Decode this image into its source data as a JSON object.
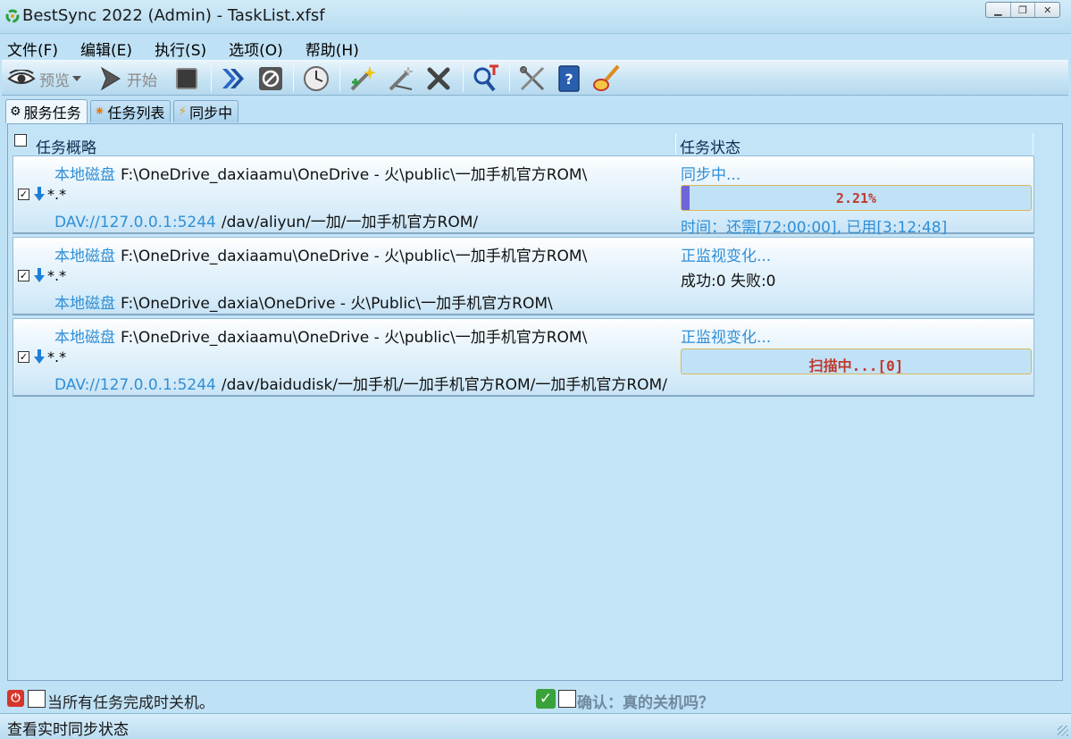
{
  "window": {
    "title": "BestSync 2022 (Admin) - TaskList.xfsf",
    "controls": [
      "minimize",
      "restore",
      "close"
    ]
  },
  "menu": [
    "文件(F)",
    "编辑(E)",
    "执行(S)",
    "选项(O)",
    "帮助(H)"
  ],
  "toolbar": {
    "preview_label": "预览",
    "start_label": "开始",
    "icons": [
      "eye-icon",
      "play-icon",
      "stop-icon",
      "fast-forward-icon",
      "cancel-icon",
      "clock-icon",
      "new-task-icon",
      "edit-task-icon",
      "delete-icon",
      "search-icon",
      "tools-icon",
      "help-book-icon",
      "clean-icon"
    ]
  },
  "tabs": [
    {
      "label": "服务任务",
      "icon": "gear-icon",
      "active": true
    },
    {
      "label": "任务列表",
      "icon": "star-icon",
      "active": false
    },
    {
      "label": "同步中",
      "icon": "lightning-icon",
      "active": false
    }
  ],
  "table": {
    "col_summary": "任务概略",
    "col_status": "任务状态"
  },
  "tasks": [
    {
      "src_label": "本地磁盘",
      "src_path": "F:\\OneDrive_daxiaamu\\OneDrive - 火\\public\\一加手机官方ROM\\",
      "filter": "*.*",
      "dst_label": "DAV://127.0.0.1:5244",
      "dst_path": "/dav/aliyun/一加/一加手机官方ROM/",
      "status": "同步中...",
      "progress_text": "2.21%",
      "progress_value": 0.0221,
      "time_text": "时间：还需[72:00:00], 已用[3:12:48]"
    },
    {
      "src_label": "本地磁盘",
      "src_path": "F:\\OneDrive_daxiaamu\\OneDrive - 火\\public\\一加手机官方ROM\\",
      "filter": "*.*",
      "dst_label": "本地磁盘",
      "dst_path": "F:\\OneDrive_daxia\\OneDrive - 火\\Public\\一加手机官方ROM\\",
      "status": "正监视变化...",
      "result_text": "成功:0 失败:0"
    },
    {
      "src_label": "本地磁盘",
      "src_path": "F:\\OneDrive_daxiaamu\\OneDrive - 火\\public\\一加手机官方ROM\\",
      "filter": "*.*",
      "dst_label": "DAV://127.0.0.1:5244",
      "dst_path": "/dav/baidudisk/一加手机/一加手机官方ROM/一加手机官方ROM/",
      "status": "正监视变化...",
      "scan_text": "扫描中...[0]"
    }
  ],
  "footer": {
    "shutdown_text": "当所有任务完成时关机。",
    "confirm_text": "确认：真的关机吗？"
  },
  "statusbar": {
    "text": "查看实时同步状态"
  },
  "colors": {
    "background": "#bfe1f5",
    "link_blue": "#2f8fd6",
    "progress_text": "#c0392b",
    "progress_fill": "#6f66d8"
  }
}
